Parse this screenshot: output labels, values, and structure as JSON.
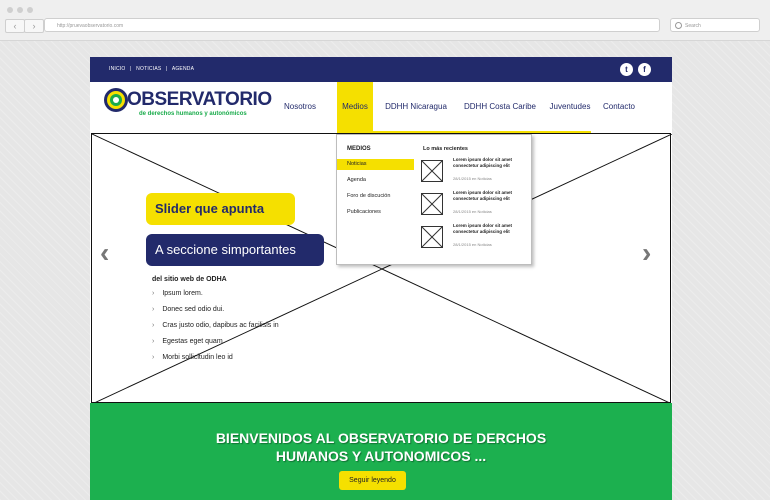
{
  "browser": {
    "url": "http://pruevaobservatorio.com",
    "search_placeholder": "Search"
  },
  "topbar": {
    "links": [
      "INICIO",
      "NOTICIAS",
      "AGENDA"
    ],
    "separator": "|",
    "social": {
      "twitter": "t",
      "facebook": "f"
    }
  },
  "logo": {
    "title": "OBSERVATORIO",
    "subtitle": "de derechos humanos y autonómicos"
  },
  "nav": {
    "items": [
      "Nosotros",
      "Medios",
      "DDHH Nicaragua",
      "DDHH Costa Caribe",
      "Juventudes",
      "Contacto"
    ],
    "active": "Medios"
  },
  "dropdown": {
    "heading": "MEDIOS",
    "items": [
      "Noticias",
      "Agenda",
      "Foro de discución",
      "Publicaciones"
    ],
    "selected": "Noticias",
    "recent_heading": "Lo más recientes",
    "recent": [
      {
        "text": "Lorem ipsum dolor sit amet consectetur adipiscing elit",
        "date": "28/1/2015 en Noticias"
      },
      {
        "text": "Lorem ipsum dolor sit amet consectetur adipiscing elit",
        "date": "28/1/2015 en Noticias"
      },
      {
        "text": "Lorem ipsum dolor sit amet consectetur adipiscing elit",
        "date": "28/1/2015 en Noticias"
      }
    ]
  },
  "slider": {
    "pill1": "Slider que apunta",
    "pill2": "A seccione simportantes",
    "heading": "del sitio web de ODHA",
    "bullets": [
      "Ipsum lorem.",
      "Donec sed odio dui.",
      "Cras justo odio, dapibus ac facilisis in",
      "Egestas eget quam",
      "Morbi sollicitudin leo id"
    ],
    "prev_icon": "‹",
    "next_icon": "›"
  },
  "banner": {
    "line1": "BIENVENIDOS AL OBSERVATORIO DE DERCHOS",
    "line2": "HUMANOS Y AUTONOMICOS ...",
    "button": "Seguir leyendo"
  },
  "colors": {
    "navy": "#222a6b",
    "yellow": "#f5e000",
    "green": "#1cb04f"
  }
}
